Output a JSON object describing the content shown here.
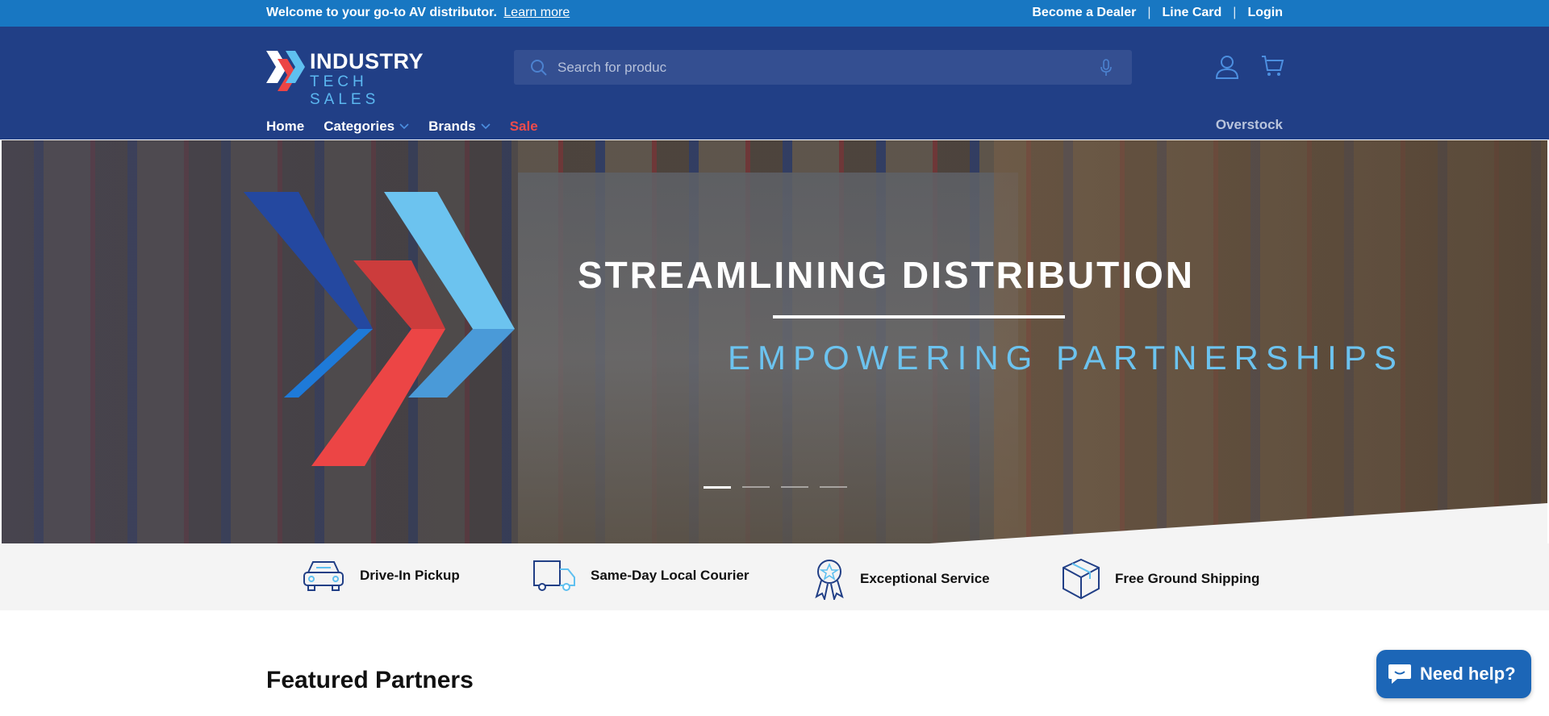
{
  "announcement": {
    "text": "Welcome to your go-to AV distributor.",
    "link": "Learn more",
    "links": [
      "Become a Dealer",
      "Line Card",
      "Login"
    ],
    "separator": "|"
  },
  "header": {
    "logo_word1": "INDUSTRY",
    "logo_word2": "TECH SALES",
    "search_placeholder": "Search for produc",
    "icons": [
      "account-icon",
      "cart-icon"
    ]
  },
  "nav": {
    "items": [
      "Home",
      "Categories",
      "Brands",
      "Sale"
    ],
    "right": "Overstock"
  },
  "hero": {
    "title": "STREAMLINING DISTRIBUTION",
    "subtitle": "EMPOWERING PARTNERSHIPS",
    "slides": 4,
    "active_slide": 1
  },
  "features": [
    {
      "icon": "car-icon",
      "label": "Drive-In Pickup"
    },
    {
      "icon": "truck-icon",
      "label": "Same-Day Local Courier"
    },
    {
      "icon": "ribbon-icon",
      "label": "Exceptional Service"
    },
    {
      "icon": "box-icon",
      "label": "Free Ground Shipping"
    }
  ],
  "section_title": "Featured Partners",
  "chat": {
    "label": "Need help?"
  },
  "colors": {
    "announce_bg": "#1877c2",
    "header_bg": "#213f86",
    "sale": "#ef4b4b",
    "accent_light": "#6cc3ef",
    "chevron_dark": "#2a4b9b",
    "chevron_red": "#ec4545",
    "chevron_light": "#5fc0f0"
  }
}
